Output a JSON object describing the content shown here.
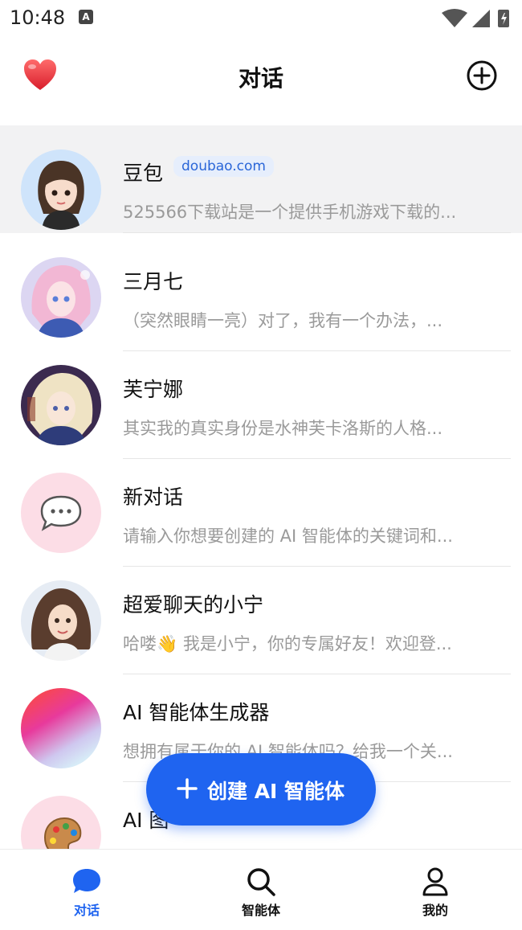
{
  "status": {
    "time": "10:48",
    "badge": "A"
  },
  "header": {
    "title": "对话"
  },
  "conversations": [
    {
      "name": "豆包",
      "tag": "doubao.com",
      "preview": "525566下载站是一个提供手机游戏下载的...",
      "avatar": "woman-avatar"
    },
    {
      "name": "三月七",
      "preview": "（突然眼睛一亮）对了，我有一个办法，...",
      "avatar": "anime-girl-pink-avatar"
    },
    {
      "name": "芙宁娜",
      "preview": "其实我的真实身份是水神芙卡洛斯的人格...",
      "avatar": "anime-girl-blonde-avatar"
    },
    {
      "name": "新对话",
      "preview": "请输入你想要创建的 AI 智能体的关键词和...",
      "avatar": "chat-bubble-icon"
    },
    {
      "name": "超爱聊天的小宁",
      "preview": "哈喽👋 我是小宁，你的专属好友！欢迎登...",
      "avatar": "girl-portrait-avatar"
    },
    {
      "name": "AI 智能体生成器",
      "preview": "想拥有属于你的 AI 智能体吗？给我一个关...",
      "avatar": "gradient-orb-avatar"
    },
    {
      "name": "AI 图",
      "preview": "",
      "avatar": "palette-icon"
    }
  ],
  "fab": {
    "label": "创建 AI 智能体"
  },
  "tabs": [
    {
      "label": "对话",
      "icon": "chat-icon",
      "active": true
    },
    {
      "label": "智能体",
      "icon": "search-icon",
      "active": false
    },
    {
      "label": "我的",
      "icon": "profile-icon",
      "active": false
    }
  ],
  "colors": {
    "accent": "#1f64f0",
    "muted_text": "#9a9a9a",
    "active_row": "#f2f2f3",
    "tag_bg": "#e6eefc",
    "tag_text": "#2a66d8"
  }
}
